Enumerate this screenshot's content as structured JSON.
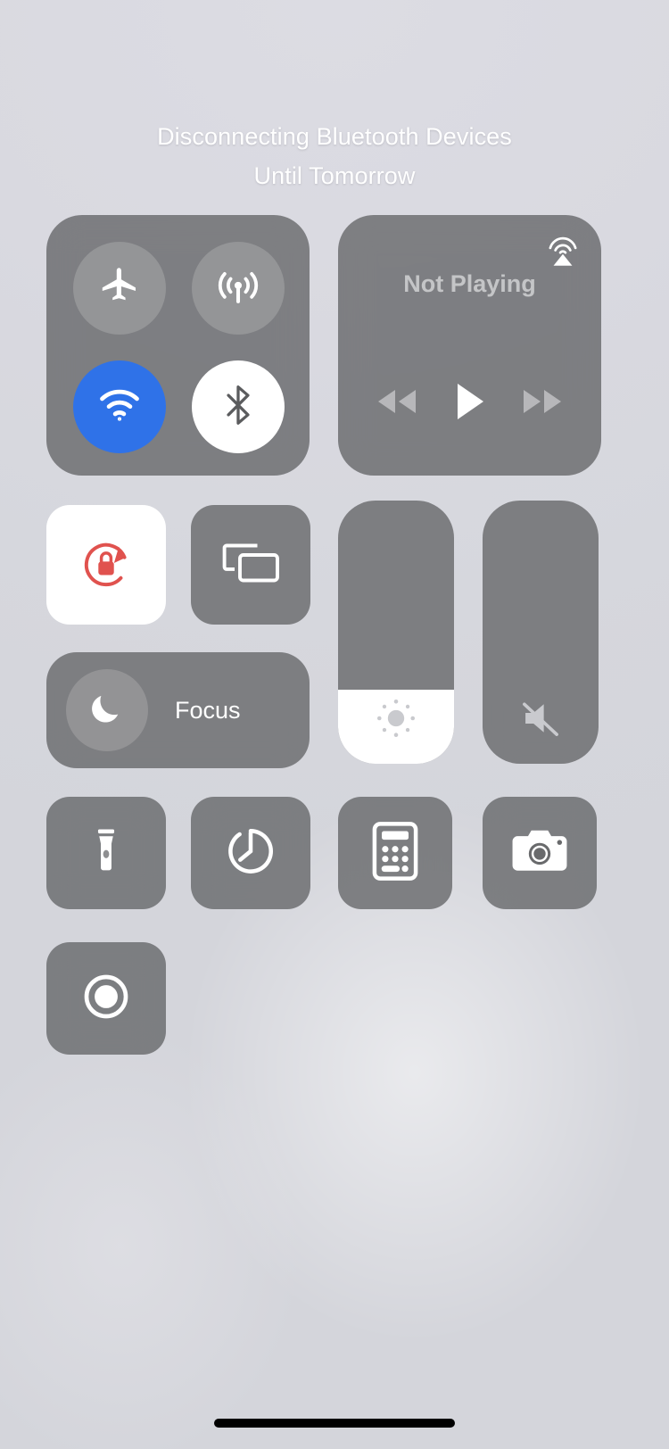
{
  "banner": {
    "line1": "Disconnecting Bluetooth Devices",
    "line2": "Until Tomorrow"
  },
  "colors": {
    "background": "#dcdce2",
    "tile_gray": "#696a6c",
    "control_gray": "#969799",
    "wifi_blue": "#2f72e8",
    "rotation_lock_red": "#e0524e",
    "white": "#ffffff",
    "home_indicator": "#000000"
  },
  "connectivity": {
    "buttons": [
      {
        "name": "airplane-mode",
        "icon": "airplane-icon",
        "state": "off"
      },
      {
        "name": "cellular-data",
        "icon": "cellular-antenna-icon",
        "state": "off"
      },
      {
        "name": "wifi",
        "icon": "wifi-icon",
        "state": "on"
      },
      {
        "name": "bluetooth",
        "icon": "bluetooth-icon",
        "state": "disconnecting"
      }
    ]
  },
  "media": {
    "now_playing": "Not Playing",
    "airplay_icon": "airplay-icon",
    "controls": [
      {
        "name": "rewind",
        "icon": "rewind-icon"
      },
      {
        "name": "play",
        "icon": "play-icon"
      },
      {
        "name": "fast-forward",
        "icon": "fast-forward-icon"
      }
    ]
  },
  "tiles": {
    "rotation_lock": {
      "icon": "rotation-lock-icon",
      "state": "on"
    },
    "screen_mirroring": {
      "icon": "screen-mirroring-icon",
      "state": "off"
    },
    "focus": {
      "label": "Focus",
      "icon": "moon-icon",
      "state": "off"
    }
  },
  "sliders": {
    "brightness": {
      "icon": "brightness-icon",
      "value": 28,
      "unit": "%"
    },
    "volume": {
      "icon": "volume-muted-icon",
      "value": 0,
      "unit": "%",
      "muted": true
    }
  },
  "utilities": [
    {
      "name": "flashlight",
      "icon": "flashlight-icon"
    },
    {
      "name": "timer",
      "icon": "timer-icon"
    },
    {
      "name": "calculator",
      "icon": "calculator-icon"
    },
    {
      "name": "camera",
      "icon": "camera-icon"
    },
    {
      "name": "screen-recording",
      "icon": "screen-record-icon"
    }
  ]
}
